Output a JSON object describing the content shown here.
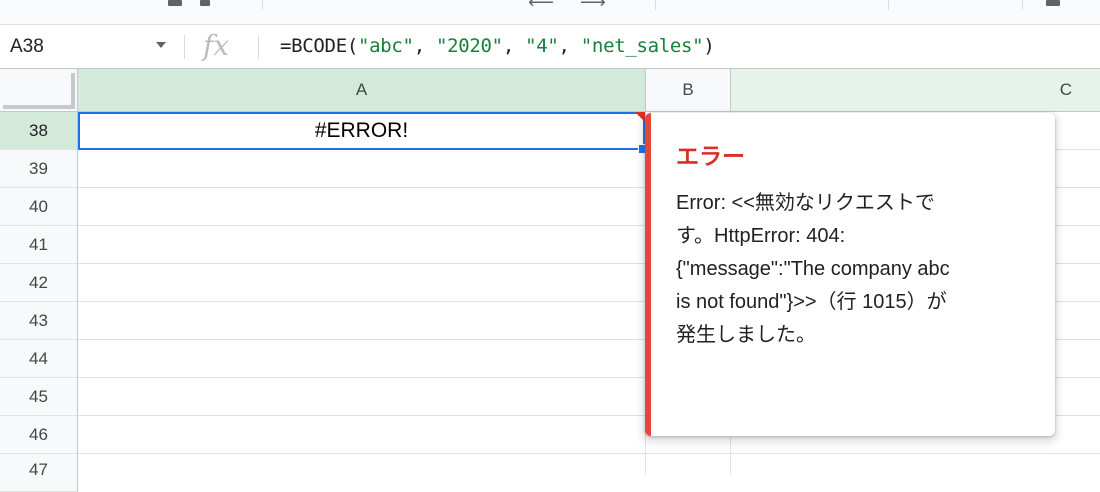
{
  "name_box": {
    "value": "A38"
  },
  "formula_bar": {
    "fx_icon": "fx",
    "prefix": "=BCODE(",
    "arg1": "\"abc\"",
    "arg2": "\"2020\"",
    "arg3": "\"4\"",
    "arg4": "\"net_sales\"",
    "sep": ", ",
    "suffix": ")"
  },
  "columns": [
    "A",
    "B",
    "C"
  ],
  "rows": [
    "38",
    "39",
    "40",
    "41",
    "42",
    "43",
    "44",
    "45",
    "46",
    "47"
  ],
  "selected_cell": {
    "ref": "A38",
    "value": "#ERROR!"
  },
  "error_popup": {
    "title": "エラー",
    "message": "Error: <<無効なリクエストで\nす。HttpError: 404:\n{\"message\":\"The company abc\nis not found\"}>>（行 1015）が\n発生しました。"
  },
  "colors": {
    "accent": "#1a73e8",
    "error": "#d93025",
    "selected_header": "#d3e9da",
    "formula_string": "#188038"
  }
}
